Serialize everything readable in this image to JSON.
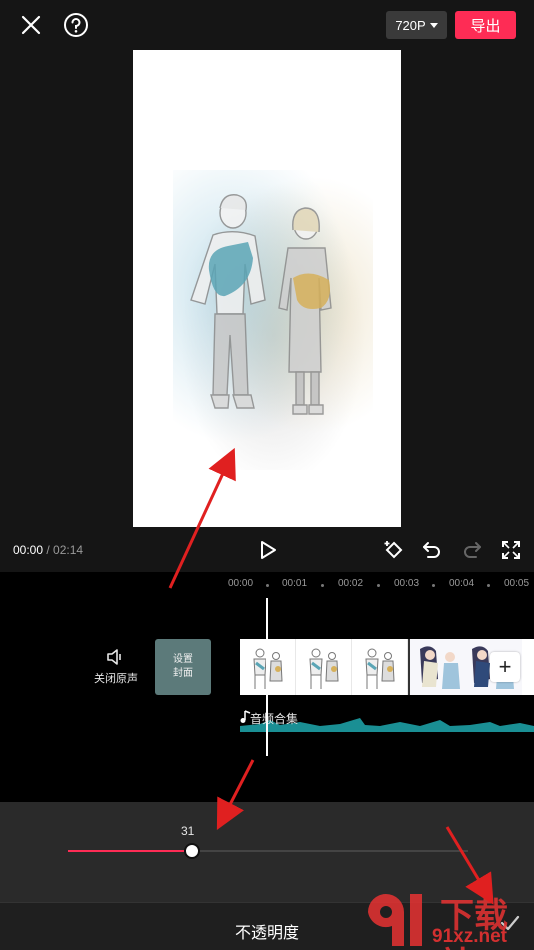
{
  "header": {
    "resolution_label": "720P",
    "export_label": "导出"
  },
  "playback": {
    "current_time": "00:00",
    "separator": " / ",
    "total_time": "02:14"
  },
  "timeline": {
    "ruler_ticks": [
      "00:00",
      "00:01",
      "00:02",
      "00:03",
      "00:04",
      "00:05"
    ],
    "mute_label": "关闭原声",
    "cover_label_line1": "设置",
    "cover_label_line2": "封面",
    "audio_track_label": "音频合集",
    "add_label": "+"
  },
  "opacity_panel": {
    "value_label": "31",
    "value": 31,
    "max": 100,
    "title": "不透明度"
  },
  "watermark": {
    "top_text": "下载站",
    "bottom_text": "91xz.net"
  },
  "colors": {
    "accent": "#fe2c55",
    "annotation_arrow": "#e02020",
    "background": "#151515",
    "panel": "#2a2a2a"
  }
}
